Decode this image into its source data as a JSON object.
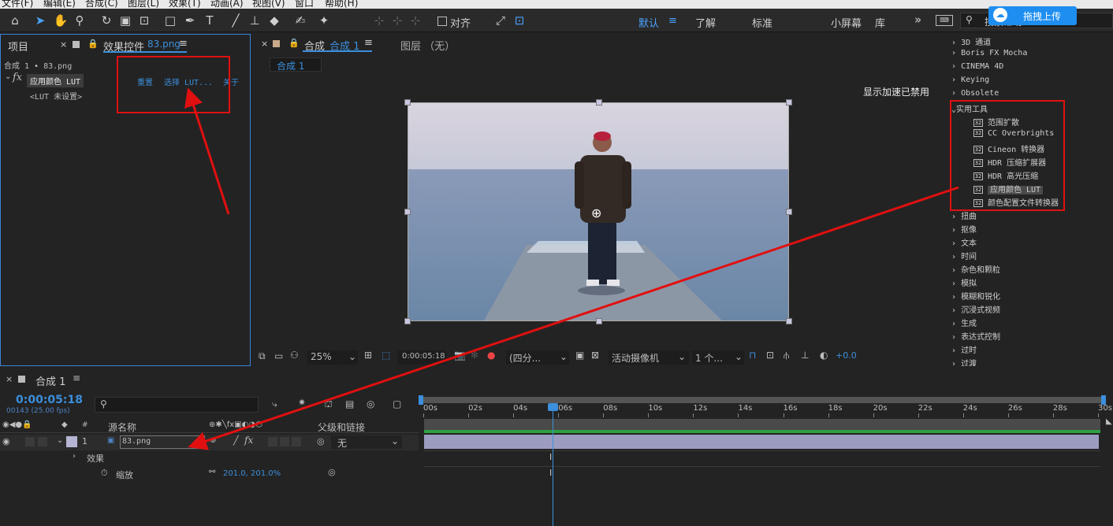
{
  "menu": [
    "文件(F)",
    "编辑(E)",
    "合成(C)",
    "图层(L)",
    "效果(T)",
    "动画(A)",
    "视图(V)",
    "窗口",
    "帮助(H)"
  ],
  "toolbar": {
    "align_label": "对齐",
    "workspaces": [
      "默认",
      "了解",
      "标准",
      "小屏幕",
      "库"
    ],
    "search_placeholder": "搜索帮助"
  },
  "upload": {
    "label": "拖拽上传"
  },
  "left_panel": {
    "tab_project": "项目",
    "tab_effects": "效果控件",
    "tab_effects_file": "83.png",
    "breadcrumb": "合成 1 • 83.png",
    "effect_name": "应用颜色 LUT",
    "reset": "重置",
    "select_lut": "选择 LUT...",
    "about": "关于",
    "lut_status": "<LUT 未设置>"
  },
  "comp_panel": {
    "tab_comp": "合成",
    "tab_comp_name": "合成 1",
    "tab_layer": "图层 （无）",
    "comp_chip": "合成 1",
    "accel_msg": "显示加速已禁用"
  },
  "viewer_bar": {
    "zoom": "25%",
    "timecode": "0:00:05:18",
    "resolution": "(四分...",
    "camera": "活动摄像机",
    "views": "1 个...",
    "exposure": "+0.0"
  },
  "effects_list": {
    "groups_top": [
      "3D 通道",
      "Boris FX Mocha",
      "CINEMA 4D",
      "Keying",
      "Obsolete"
    ],
    "open_group": "实用工具",
    "items": [
      "范围扩散",
      "CC Overbrights",
      "Cineon 转换器",
      "HDR 压缩扩展器",
      "HDR 高光压缩",
      "应用颜色 LUT",
      "颜色配置文件转换器"
    ],
    "groups_bottom": [
      "扭曲",
      "抠像",
      "文本",
      "时间",
      "杂色和颗粒",
      "模拟",
      "模糊和锐化",
      "沉浸式视频",
      "生成",
      "表达式控制",
      "过时",
      "过渡"
    ]
  },
  "timeline": {
    "tab": "合成 1",
    "timecode": "0:00:05:18",
    "frames": "00143 (25.00 fps)",
    "col_source": "源名称",
    "col_parent": "父级和链接",
    "layer_num": "1",
    "layer_name": "83.png",
    "parent_value": "无",
    "effects_row": "效果",
    "scale_label": "缩放",
    "scale_value": "201.0, 201.0%",
    "ticks": [
      "00s",
      "02s",
      "04s",
      "06s",
      "08s",
      "10s",
      "12s",
      "14s",
      "16s",
      "18s",
      "20s",
      "22s",
      "24s",
      "26s",
      "28s",
      "30s"
    ]
  },
  "colors": {
    "accent": "#3b8fdc",
    "annotation": "#e01010",
    "track": "#9c9cc0"
  }
}
